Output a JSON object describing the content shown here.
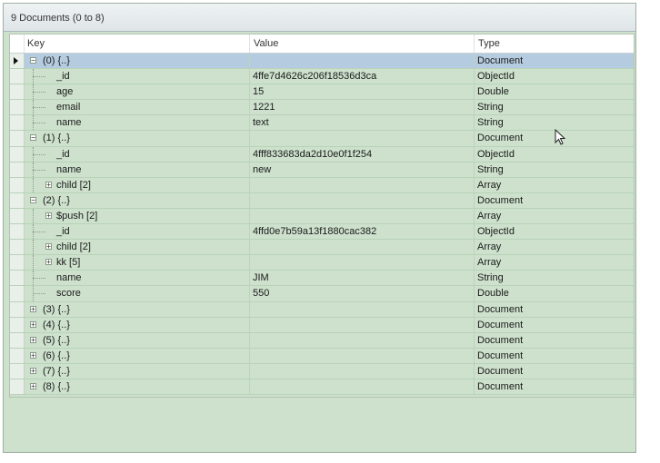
{
  "header": {
    "title": "9 Documents (0 to 8)"
  },
  "columns": {
    "key": "Key",
    "value": "Value",
    "type": "Type"
  },
  "rows": [
    {
      "key": "(0) {..}",
      "value": "",
      "type": "Document",
      "level": 0,
      "exp": "-",
      "selected": true
    },
    {
      "key": "_id",
      "value": "4ffe7d4626c206f18536d3ca",
      "type": "ObjectId",
      "level": 1
    },
    {
      "key": "age",
      "value": "15",
      "type": "Double",
      "level": 1
    },
    {
      "key": "email",
      "value": "1221",
      "type": "String",
      "level": 1
    },
    {
      "key": "name",
      "value": "text",
      "type": "String",
      "level": 1
    },
    {
      "key": "(1) {..}",
      "value": "",
      "type": "Document",
      "level": 0,
      "exp": "-"
    },
    {
      "key": "_id",
      "value": "4fff833683da2d10e0f1f254",
      "type": "ObjectId",
      "level": 1
    },
    {
      "key": "name",
      "value": "new",
      "type": "String",
      "level": 1
    },
    {
      "key": "child [2]",
      "value": "",
      "type": "Array",
      "level": 1,
      "exp": "+"
    },
    {
      "key": "(2) {..}",
      "value": "",
      "type": "Document",
      "level": 0,
      "exp": "-"
    },
    {
      "key": "$push [2]",
      "value": "",
      "type": "Array",
      "level": 1,
      "exp": "+"
    },
    {
      "key": "_id",
      "value": "4ffd0e7b59a13f1880cac382",
      "type": "ObjectId",
      "level": 1
    },
    {
      "key": "child [2]",
      "value": "",
      "type": "Array",
      "level": 1,
      "exp": "+"
    },
    {
      "key": "kk [5]",
      "value": "",
      "type": "Array",
      "level": 1,
      "exp": "+"
    },
    {
      "key": "name",
      "value": "JIM",
      "type": "String",
      "level": 1
    },
    {
      "key": "score",
      "value": "550",
      "type": "Double",
      "level": 1
    },
    {
      "key": "(3) {..}",
      "value": "",
      "type": "Document",
      "level": 0,
      "exp": "+"
    },
    {
      "key": "(4) {..}",
      "value": "",
      "type": "Document",
      "level": 0,
      "exp": "+"
    },
    {
      "key": "(5) {..}",
      "value": "",
      "type": "Document",
      "level": 0,
      "exp": "+"
    },
    {
      "key": "(6) {..}",
      "value": "",
      "type": "Document",
      "level": 0,
      "exp": "+"
    },
    {
      "key": "(7) {..}",
      "value": "",
      "type": "Document",
      "level": 0,
      "exp": "+"
    },
    {
      "key": "(8) {..}",
      "value": "",
      "type": "Document",
      "level": 0,
      "exp": "+"
    }
  ]
}
